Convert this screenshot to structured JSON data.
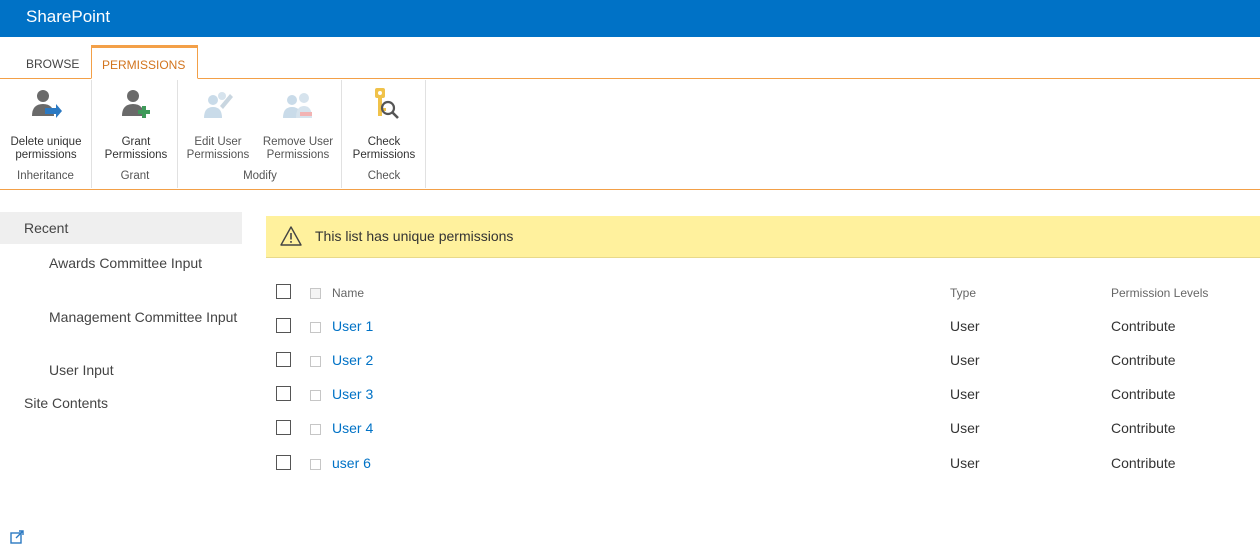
{
  "app": {
    "brand": "SharePoint"
  },
  "tabs": [
    {
      "label": "BROWSE"
    },
    {
      "label": "PERMISSIONS"
    }
  ],
  "ribbon": {
    "groups": [
      {
        "label": "Inheritance",
        "buttons": [
          {
            "label": "Delete unique\npermissions",
            "icon": "delete-permissions-icon"
          }
        ]
      },
      {
        "label": "Grant",
        "buttons": [
          {
            "label": "Grant\nPermissions",
            "icon": "grant-permissions-icon"
          }
        ]
      },
      {
        "label": "Modify",
        "buttons": [
          {
            "label": "Edit User\nPermissions",
            "icon": "edit-permissions-icon"
          },
          {
            "label": "Remove User\nPermissions",
            "icon": "remove-permissions-icon"
          }
        ]
      },
      {
        "label": "Check",
        "buttons": [
          {
            "label": "Check\nPermissions",
            "icon": "check-permissions-icon"
          }
        ]
      }
    ]
  },
  "nav": {
    "recent": "Recent",
    "recent_items": [
      {
        "label": "Awards Committee Input"
      },
      {
        "label": "Management Committee Input"
      },
      {
        "label": "User Input"
      }
    ],
    "site_contents": "Site Contents"
  },
  "banner": {
    "message": "This list has unique permissions",
    "icon": "warning-icon"
  },
  "table": {
    "headers": {
      "name": "Name",
      "type": "Type",
      "permission_levels": "Permission Levels"
    },
    "rows": [
      {
        "name": "User 1",
        "type": "User",
        "permission": "Contribute"
      },
      {
        "name": "User 2",
        "type": "User",
        "permission": "Contribute"
      },
      {
        "name": "User 3",
        "type": "User",
        "permission": "Contribute"
      },
      {
        "name": "User 4",
        "type": "User",
        "permission": "Contribute"
      },
      {
        "name": "user 6",
        "type": "User",
        "permission": "Contribute"
      }
    ]
  },
  "colors": {
    "brand_bar": "#0072c6",
    "accent_orange": "#f3a048",
    "link": "#0072c6",
    "banner": "#fff19d"
  },
  "footer": {
    "icon": "open-new-window-icon"
  }
}
